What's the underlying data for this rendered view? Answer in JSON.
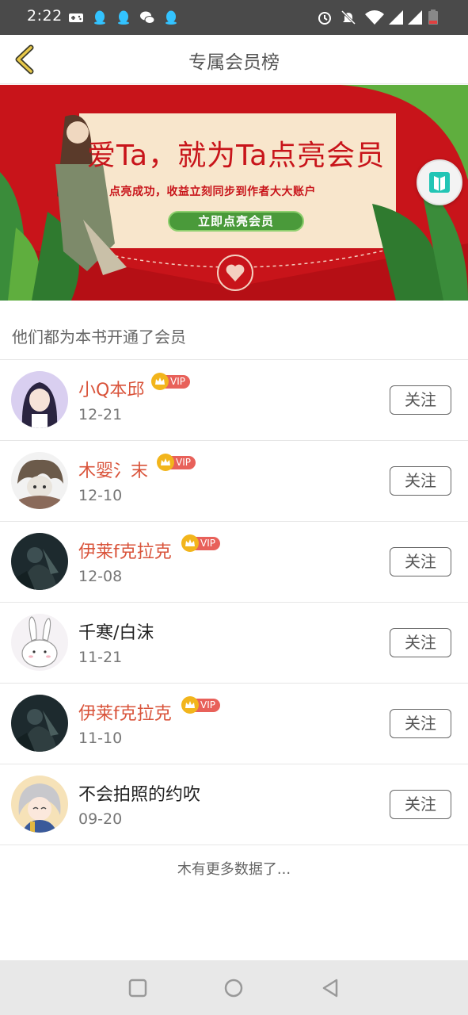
{
  "status_bar": {
    "time": "2:22",
    "left_icons": [
      "gamepad-icon",
      "qq-icon",
      "qq-icon",
      "wechat-icon",
      "qq-icon"
    ],
    "right_icons": [
      "alarm-icon",
      "mute-icon",
      "wifi-icon",
      "signal-icon",
      "signal-icon",
      "battery-icon"
    ]
  },
  "header": {
    "title": "专属会员榜",
    "back_icon": "chevron-left-icon",
    "accent": "#e8c84a"
  },
  "banner": {
    "headline": "爱Ta，就为Ta点亮会员",
    "subtitle": "点亮成功，收益立刻同步到作者大大账户",
    "cta": "立即点亮会员",
    "bg_color": "#c8141a"
  },
  "section": {
    "title": "他们都为本书开通了会员"
  },
  "members": [
    {
      "name": "小Q本邱",
      "vip": true,
      "vip_label": "VIP",
      "date": "12-21",
      "follow_label": "关注"
    },
    {
      "name": "木婴氵末",
      "vip": true,
      "vip_label": "VIP",
      "date": "12-10",
      "follow_label": "关注"
    },
    {
      "name": "伊莱f克拉克",
      "vip": true,
      "vip_label": "VIP",
      "date": "12-08",
      "follow_label": "关注"
    },
    {
      "name": "千寒/白沫",
      "vip": false,
      "vip_label": "",
      "date": "11-21",
      "follow_label": "关注"
    },
    {
      "name": "伊莱f克拉克",
      "vip": true,
      "vip_label": "VIP",
      "date": "11-10",
      "follow_label": "关注"
    },
    {
      "name": "不会拍照的约吹",
      "vip": false,
      "vip_label": "",
      "date": "09-20",
      "follow_label": "关注"
    }
  ],
  "footer_text": "木有更多数据了...",
  "nav_bar": {
    "buttons": [
      "recents-square-icon",
      "home-circle-icon",
      "back-triangle-icon"
    ]
  },
  "colors": {
    "vip_name": "#d9533a",
    "vip_badge": "#e8615a",
    "crown": "#f2b51c",
    "status_bar": "#4a4a4a"
  }
}
